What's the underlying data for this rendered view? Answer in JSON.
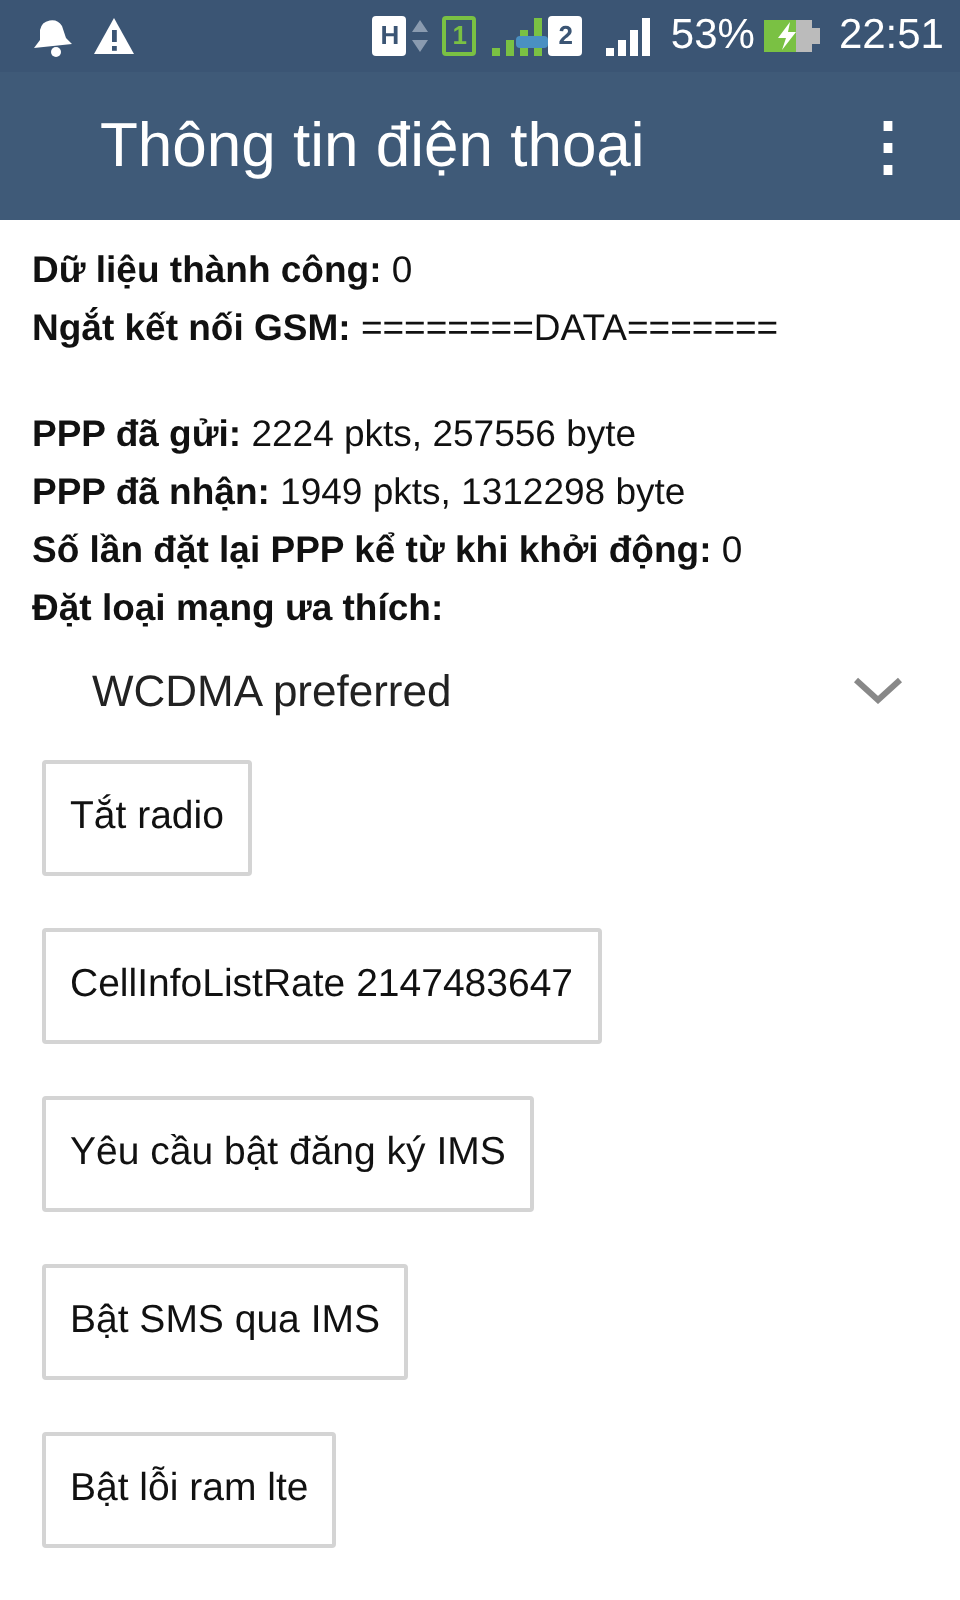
{
  "status_bar": {
    "network_type": "H",
    "sim_1": "1",
    "sim_2": "2",
    "battery": "53%",
    "time": "22:51"
  },
  "app_bar": {
    "title": "Thông tin điện thoại",
    "menu": "⋮"
  },
  "info_groups": [
    [
      {
        "label": "Dữ liệu thành công:",
        "value": "0"
      },
      {
        "label": "Ngắt kết nối GSM:",
        "value": "========DATA======="
      }
    ],
    [
      {
        "label": "PPP đã gửi:",
        "value": "2224 pkts, 257556 byte"
      },
      {
        "label": "PPP đã nhận:",
        "value": "1949 pkts, 1312298 byte"
      },
      {
        "label": "Số lần đặt lại PPP kể từ khi khởi động:",
        "value": "0"
      },
      {
        "label": "Đặt loại mạng ưa thích:"
      }
    ]
  ],
  "network_spinner": {
    "value": "WCDMA preferred"
  },
  "buttons": [
    "Tắt radio",
    "CellInfoListRate 2147483647",
    "Yêu cầu bật đăng ký IMS",
    "Bật SMS qua IMS",
    "Bật lỗi ram lte"
  ]
}
